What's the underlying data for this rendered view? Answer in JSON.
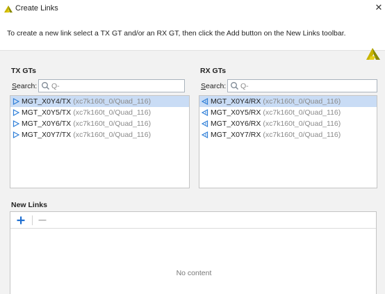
{
  "window": {
    "title": "Create Links",
    "close_glyph": "✕"
  },
  "banner": {
    "text": "To create a new link select a TX GT and/or an RX GT, then click the Add button on the New Links toolbar."
  },
  "tx": {
    "label": "TX GTs",
    "search_prefix": "",
    "search_key": "S",
    "search_rest": "earch:",
    "search_placeholder": "Q-",
    "items": [
      {
        "name": "MGT_X0Y4/TX",
        "path": "(xc7k160t_0/Quad_116)",
        "selected": true
      },
      {
        "name": "MGT_X0Y5/TX",
        "path": "(xc7k160t_0/Quad_116)",
        "selected": false
      },
      {
        "name": "MGT_X0Y6/TX",
        "path": "(xc7k160t_0/Quad_116)",
        "selected": false
      },
      {
        "name": "MGT_X0Y7/TX",
        "path": "(xc7k160t_0/Quad_116)",
        "selected": false
      }
    ]
  },
  "rx": {
    "label": "RX GTs",
    "search_key": "S",
    "search_rest": "earch:",
    "search_placeholder": "Q-",
    "items": [
      {
        "name": "MGT_X0Y4/RX",
        "path": "(xc7k160t_0/Quad_116)",
        "selected": true
      },
      {
        "name": "MGT_X0Y5/RX",
        "path": "(xc7k160t_0/Quad_116)",
        "selected": false
      },
      {
        "name": "MGT_X0Y6/RX",
        "path": "(xc7k160t_0/Quad_116)",
        "selected": false
      },
      {
        "name": "MGT_X0Y7/RX",
        "path": "(xc7k160t_0/Quad_116)",
        "selected": false
      }
    ]
  },
  "new_links": {
    "label": "New Links",
    "add_icon": "plus-icon",
    "remove_icon": "minus-icon",
    "empty_text": "No content"
  },
  "colors": {
    "accent_blue": "#1f6fd1",
    "selection": "#c9dcf5",
    "logo_yellow": "#c8b400"
  }
}
